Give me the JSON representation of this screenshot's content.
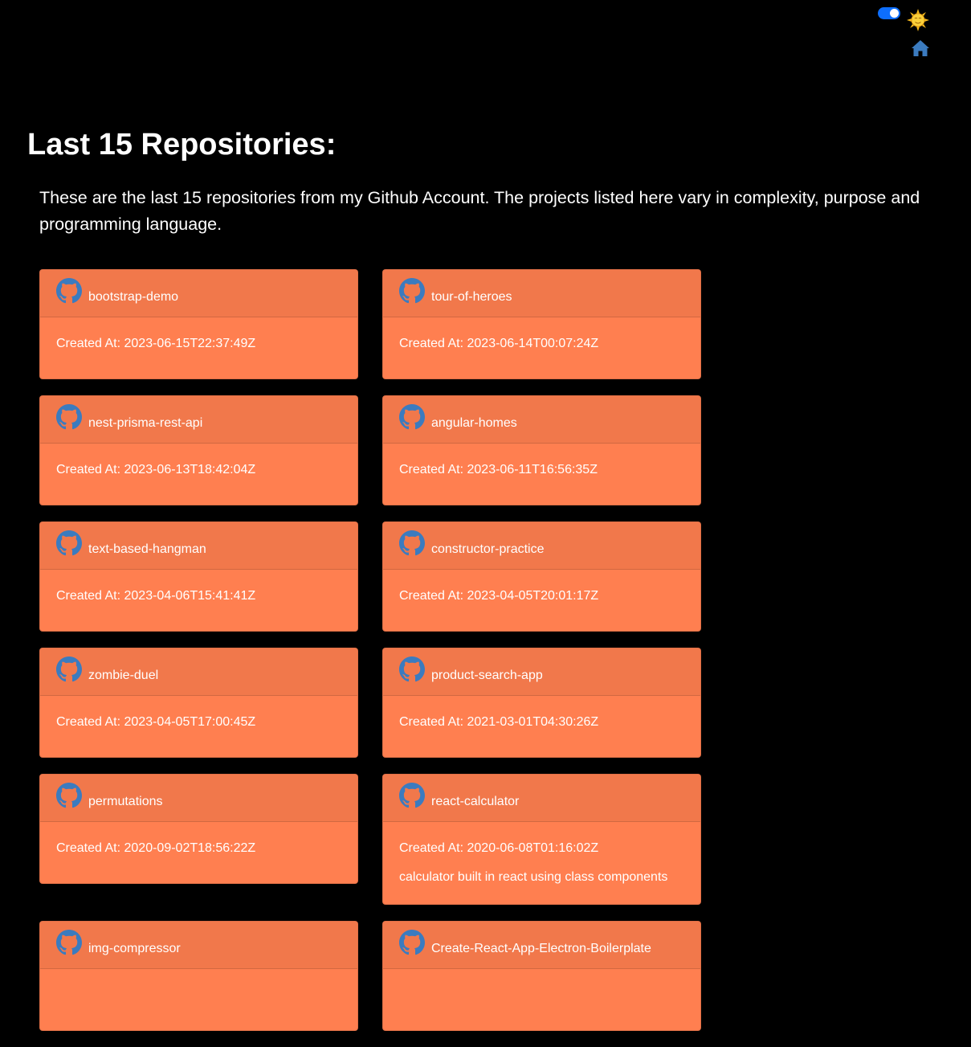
{
  "header": {
    "theme_toggle_on": true,
    "theme_icon": "sun-icon",
    "home_icon": "home-icon"
  },
  "page": {
    "title": "Last 15 Repositories:",
    "intro": "These are the last 15 repositories from my Github Account. The projects listed here vary in complexity, purpose and programming language."
  },
  "colors": {
    "background": "#000000",
    "card": "#ff7f50",
    "card_header": "#f1784b",
    "icon_blue": "#3b7bbf",
    "toggle": "#0d6efd"
  },
  "repos": [
    {
      "name": "bootstrap-demo",
      "created": "Created At: 2023-06-15T22:37:49Z",
      "description": ""
    },
    {
      "name": "tour-of-heroes",
      "created": "Created At: 2023-06-14T00:07:24Z",
      "description": ""
    },
    {
      "name": "nest-prisma-rest-api",
      "created": "Created At: 2023-06-13T18:42:04Z",
      "description": ""
    },
    {
      "name": "angular-homes",
      "created": "Created At: 2023-06-11T16:56:35Z",
      "description": ""
    },
    {
      "name": "text-based-hangman",
      "created": "Created At: 2023-04-06T15:41:41Z",
      "description": ""
    },
    {
      "name": "constructor-practice",
      "created": "Created At: 2023-04-05T20:01:17Z",
      "description": ""
    },
    {
      "name": "zombie-duel",
      "created": "Created At: 2023-04-05T17:00:45Z",
      "description": ""
    },
    {
      "name": "product-search-app",
      "created": "Created At: 2021-03-01T04:30:26Z",
      "description": ""
    },
    {
      "name": "permutations",
      "created": "Created At: 2020-09-02T18:56:22Z",
      "description": ""
    },
    {
      "name": "react-calculator",
      "created": "Created At: 2020-06-08T01:16:02Z",
      "description": "calculator built in react using class components"
    },
    {
      "name": "img-compressor",
      "created": "",
      "description": ""
    },
    {
      "name": "Create-React-App-Electron-Boilerplate",
      "created": "",
      "description": ""
    }
  ]
}
